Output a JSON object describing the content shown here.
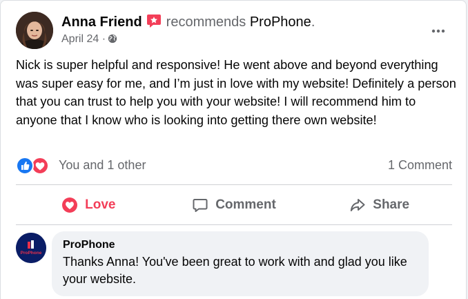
{
  "post": {
    "author": "Anna Friend",
    "verb": "recommends",
    "page": "ProPhone",
    "period": ".",
    "date": "April 24",
    "separator": "·",
    "body": "Nick is super helpful and responsive! He went above and beyond everything was super easy for me, and I’m just in love with my website! Definitely a person that you can trust to help you with your website! I will recommend him to anyone that I know who is looking into getting there own website!"
  },
  "stats": {
    "reactions_text": "You and 1 other",
    "comments_text": "1 Comment"
  },
  "actions": {
    "love_label": "Love",
    "comment_label": "Comment",
    "share_label": "Share"
  },
  "comment": {
    "author": "ProPhone",
    "avatar_text": "ProPhone",
    "text": "Thanks Anna! You've been great to work with and glad you like your website."
  },
  "colors": {
    "love": "#f33e58",
    "like": "#1877f2",
    "secondary_text": "#65676b",
    "bubble": "#f0f2f5"
  }
}
